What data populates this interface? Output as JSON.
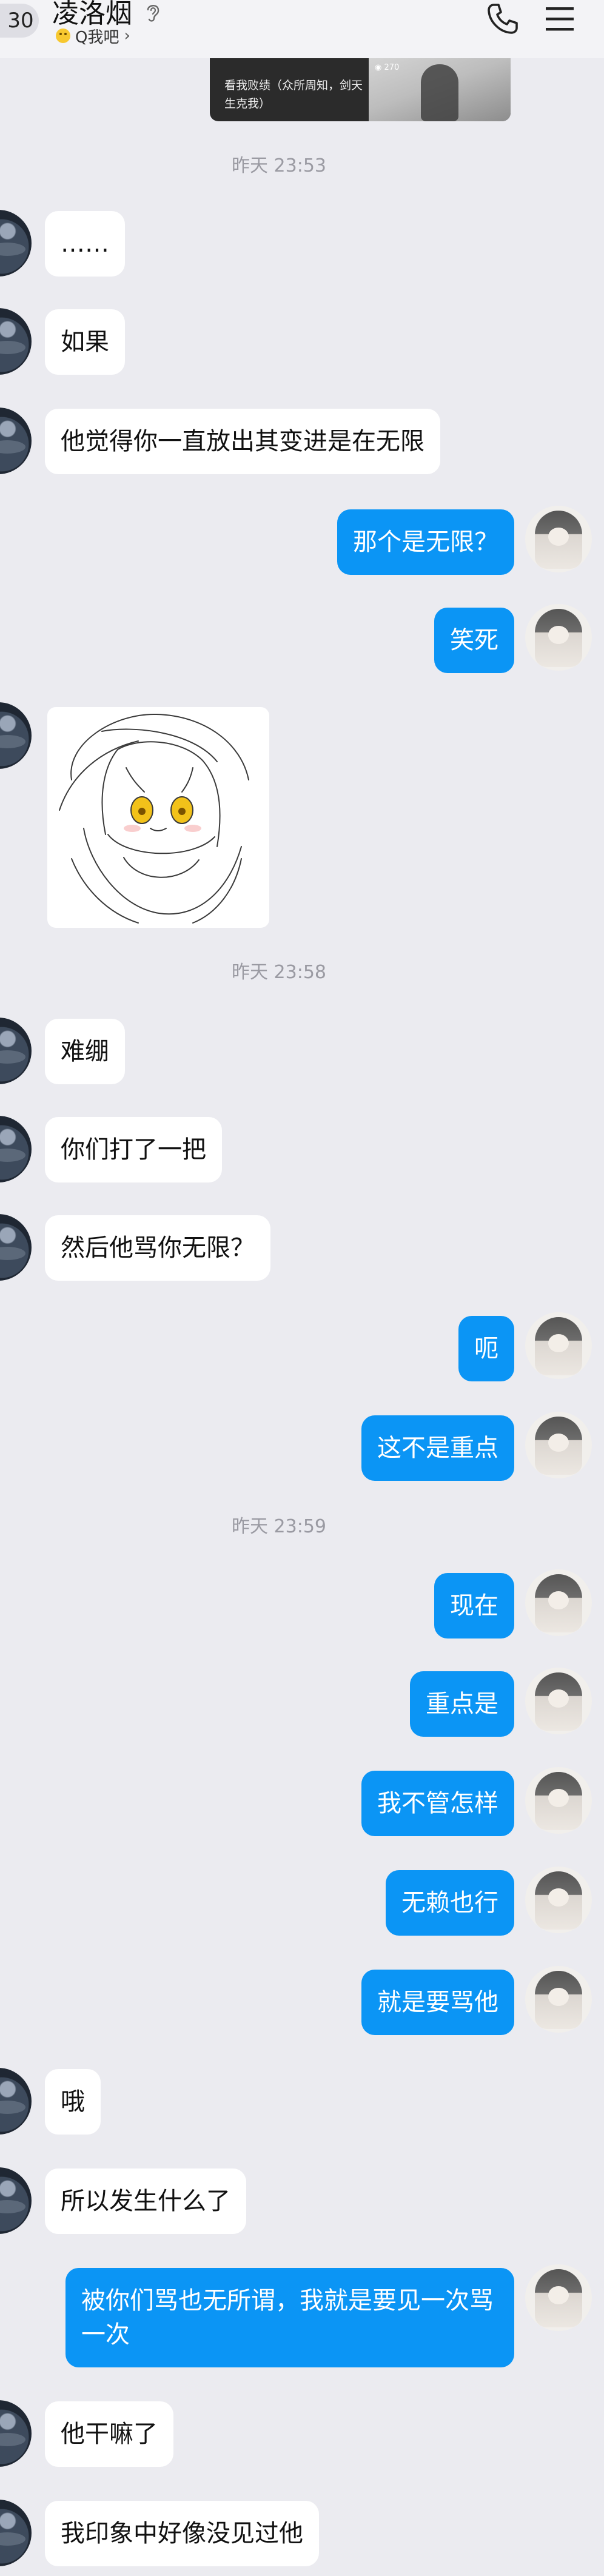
{
  "header": {
    "unread_count": "30",
    "contact_name": "凌洛烟",
    "status_text": "Q我吧",
    "status_chevron": "›",
    "icons": [
      "ear-icon",
      "phone-icon",
      "menu-icon",
      "status-emoji-icon"
    ]
  },
  "card": {
    "caption": "看我败绩（众所周知，剑天生克我）",
    "views": "◉ 270"
  },
  "timestamps": [
    "昨天 23:53",
    "昨天 23:58",
    "昨天 23:59"
  ],
  "messages": [
    {
      "side": "in",
      "text": "……"
    },
    {
      "side": "in",
      "text": "如果"
    },
    {
      "side": "in",
      "text": "他觉得你一直放出其变进是在无限"
    },
    {
      "side": "out",
      "text": "那个是无限？"
    },
    {
      "side": "out",
      "text": "笑死"
    },
    {
      "side": "in",
      "type": "sticker",
      "text": "anime-girl-sticker"
    },
    {
      "side": "in",
      "text": "难绷"
    },
    {
      "side": "in",
      "text": "你们打了一把"
    },
    {
      "side": "in",
      "text": "然后他骂你无限？"
    },
    {
      "side": "out",
      "text": "呃"
    },
    {
      "side": "out",
      "text": "这不是重点"
    },
    {
      "side": "out",
      "text": "现在"
    },
    {
      "side": "out",
      "text": "重点是"
    },
    {
      "side": "out",
      "text": "我不管怎样"
    },
    {
      "side": "out",
      "text": "无赖也行"
    },
    {
      "side": "out",
      "text": "就是要骂他"
    },
    {
      "side": "in",
      "text": "哦"
    },
    {
      "side": "in",
      "text": "所以发生什么了"
    },
    {
      "side": "out",
      "text": "被你们骂也无所谓，我就是要见一次骂一次"
    },
    {
      "side": "in",
      "text": "他干嘛了"
    },
    {
      "side": "in",
      "text": "我印象中好像没见过他"
    }
  ],
  "colors": {
    "background": "#ebebf0",
    "incoming_bubble": "#ffffff",
    "outgoing_bubble": "#0b95f5",
    "timestamp_text": "#9a9aa2"
  }
}
